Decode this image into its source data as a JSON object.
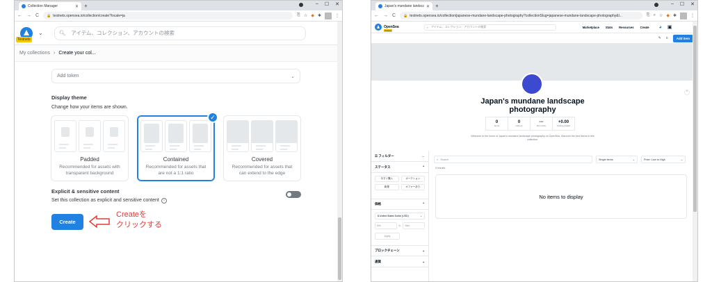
{
  "left": {
    "tab_title": "Collection Manager",
    "url": "testnets.opensea.io/collection/create?locale=ja",
    "search_placeholder": "アイテム、コレクション、アカウントの検索",
    "testnet_badge": "Testnets",
    "breadcrumb": {
      "parent": "My collections",
      "current": "Create your col..."
    },
    "add_token": "Add token",
    "display_theme": {
      "title": "Display theme",
      "subtitle": "Change how your items are shown.",
      "options": [
        {
          "name": "Padded",
          "desc": "Recommended for assets with transparent background",
          "selected": false
        },
        {
          "name": "Contained",
          "desc": "Recommended for assets that are not a 1:1 ratio",
          "selected": true
        },
        {
          "name": "Covered",
          "desc": "Recommended for assets that can extend to the edge",
          "selected": false
        }
      ]
    },
    "explicit": {
      "title": "Explicit & sensitive content",
      "desc": "Set this collection as explicit and sensitive content",
      "enabled": false
    },
    "create_label": "Create",
    "annotation_line1": "Createを",
    "annotation_line2": "クリックする"
  },
  "right": {
    "tab_title": "Japan's mundane landscape ph...",
    "url": "testnets.opensea.io/collection/japanese-mundane-landscape-photography?collectionSlug=japanese-mundane-landscape-photography&l...",
    "brand": "OpenSea",
    "testnet_badge": "Testnet",
    "search_placeholder": "アイテム、コレクション、アカウントの検索",
    "nav": [
      "Marketplace",
      "Stats",
      "Resources",
      "Create"
    ],
    "add_item": "Add item",
    "collection_title": "Japan's mundane landscape photography",
    "stats": [
      {
        "value": "0",
        "label": "items"
      },
      {
        "value": "0",
        "label": "owners"
      },
      {
        "value": "---",
        "label": "floor price"
      },
      {
        "value": "+0.00",
        "label": "volume traded"
      }
    ],
    "welcome": "Welcome to the home of Japan's mundane landscape photography on OpenSea. Discover the best items in this collection.",
    "filter": {
      "title": "フィルター",
      "status_title": "ステータス",
      "status_options": [
        "今すぐ購入",
        "オークション",
        "新規",
        "オファーあり"
      ],
      "price_title": "価格",
      "currency": "United States Dollar (USD)",
      "min": "Min",
      "to": "to",
      "max": "Max",
      "apply": "Apply",
      "chains_title": "ブロックチェーン",
      "category_title": "通貨"
    },
    "items_search": "Search",
    "items_filter": "Single items",
    "sort": "Price: Low to High",
    "results": "0 results",
    "empty": "No items to display"
  }
}
